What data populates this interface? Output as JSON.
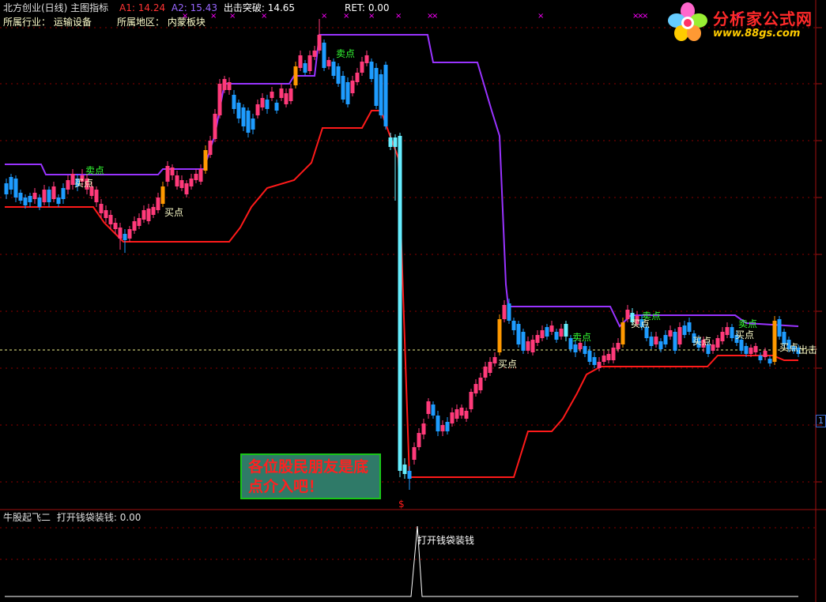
{
  "header": {
    "title": "北方创业(日线) 主图指标",
    "a1_label": "A1:",
    "a1_value": "14.24",
    "a2_label": "A2:",
    "a2_value": "15.43",
    "breakout_label": "出击突破:",
    "breakout_value": "14.65",
    "ret_label": "RET:",
    "ret_value": "0.00",
    "industry_label": "所属行业：",
    "industry_value": "运输设备",
    "region_label": "所属地区：",
    "region_value": "内蒙板块"
  },
  "logo": {
    "name": "分析家公式网",
    "url": "www.88gs.com"
  },
  "callout": {
    "line1": "各位股民朋友是底",
    "line2": "点介入吧！"
  },
  "sub_panel": {
    "title": "牛股起飞二",
    "indicator_label": "打开钱袋装钱:",
    "indicator_value": "0.00",
    "spike_label": "打开钱袋装钱"
  },
  "right_axis": {
    "marker": "1"
  },
  "colors": {
    "up_candle": "#ff3a7a",
    "down_candle": "#1e9cff",
    "accent_up": "#ff9900",
    "accent_down": "#66eeff",
    "support": "#ff1a1a",
    "resistance": "#9933ff",
    "buy_label": "#ffffcc",
    "sell_label": "#33ff33",
    "grid": "#8b0000",
    "cross": "#ff00ff"
  },
  "chart_data": {
    "type": "candlestick",
    "title": "北方创业(日线) 主图指标",
    "annotations": {
      "buy": "买点",
      "sell": "卖点",
      "attack": "出击",
      "money": "$",
      "cross": "×"
    },
    "current_price_line": 14.65
  }
}
